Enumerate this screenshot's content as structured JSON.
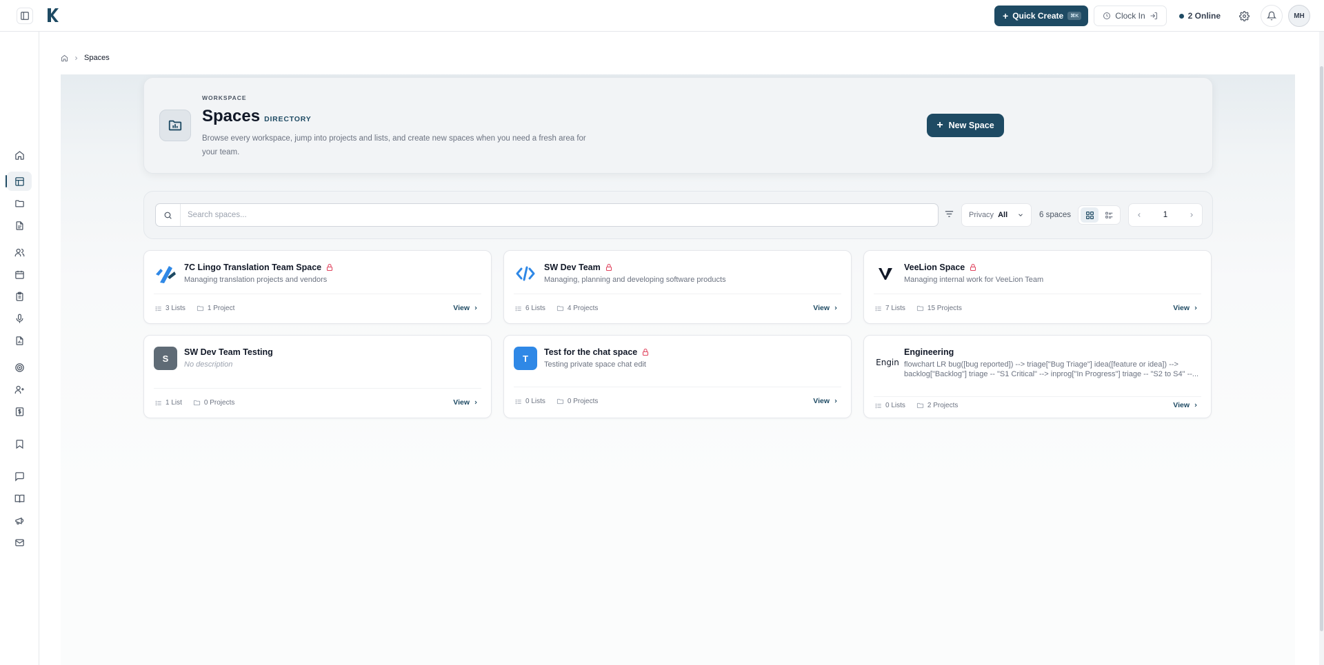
{
  "topbar": {
    "quick_create_label": "Quick Create",
    "quick_create_kbd": "⌘K",
    "clock_in_label": "Clock In",
    "online_label": "2 Online",
    "avatar_initials": "MH"
  },
  "breadcrumb": {
    "current": "Spaces"
  },
  "hero": {
    "eyebrow": "WORKSPACE",
    "title": "Spaces",
    "subtitle": "DIRECTORY",
    "description": "Browse every workspace, jump into projects and lists, and create new spaces when you need a fresh area for your team.",
    "new_space_label": "New Space"
  },
  "filters": {
    "search_placeholder": "Search spaces...",
    "privacy_label": "Privacy",
    "privacy_value": "All",
    "count_label": "6 spaces",
    "page_number": "1"
  },
  "cards": [
    {
      "title": "7C Lingo Translation Team Space",
      "description": "Managing translation projects and vendors",
      "lists": "3 Lists",
      "projects": "1 Project",
      "view": "View",
      "private": true,
      "icon": "7c-lingo-logo"
    },
    {
      "title": "SW Dev Team",
      "description": "Managing, planning and developing software products",
      "lists": "6 Lists",
      "projects": "4 Projects",
      "view": "View",
      "private": true,
      "icon": "code-icon"
    },
    {
      "title": "VeeLion Space",
      "description": "Managing internal work for VeeLion Team",
      "lists": "7 Lists",
      "projects": "15 Projects",
      "view": "View",
      "private": true,
      "icon": "veelion-logo"
    },
    {
      "title": "SW Dev Team Testing",
      "description": "No description",
      "lists": "1 List",
      "projects": "0 Projects",
      "view": "View",
      "private": false,
      "letter": "S"
    },
    {
      "title": "Test for the chat space",
      "description": "Testing private space chat edit",
      "lists": "0 Lists",
      "projects": "0 Projects",
      "view": "View",
      "private": true,
      "letter": "T"
    },
    {
      "title": "Engineering",
      "description_line1": "flowchart LR bug([bug reported]) --> triage[\"Bug Triage\"] idea([feature or idea]) -->",
      "description_line2": "backlog[\"Backlog\"] triage -- \"S1 Critical\" --> inprog[\"In Progress\"] triage -- \"S2 to S4\" --...",
      "lists": "0 Lists",
      "projects": "2 Projects",
      "view": "View",
      "private": false,
      "image_alt": "Engin"
    }
  ],
  "colors": {
    "primary": "#1e4a63",
    "lock": "#e0455f",
    "blue_tile": "#2f88e6",
    "gray_tile": "#5f6b76"
  }
}
